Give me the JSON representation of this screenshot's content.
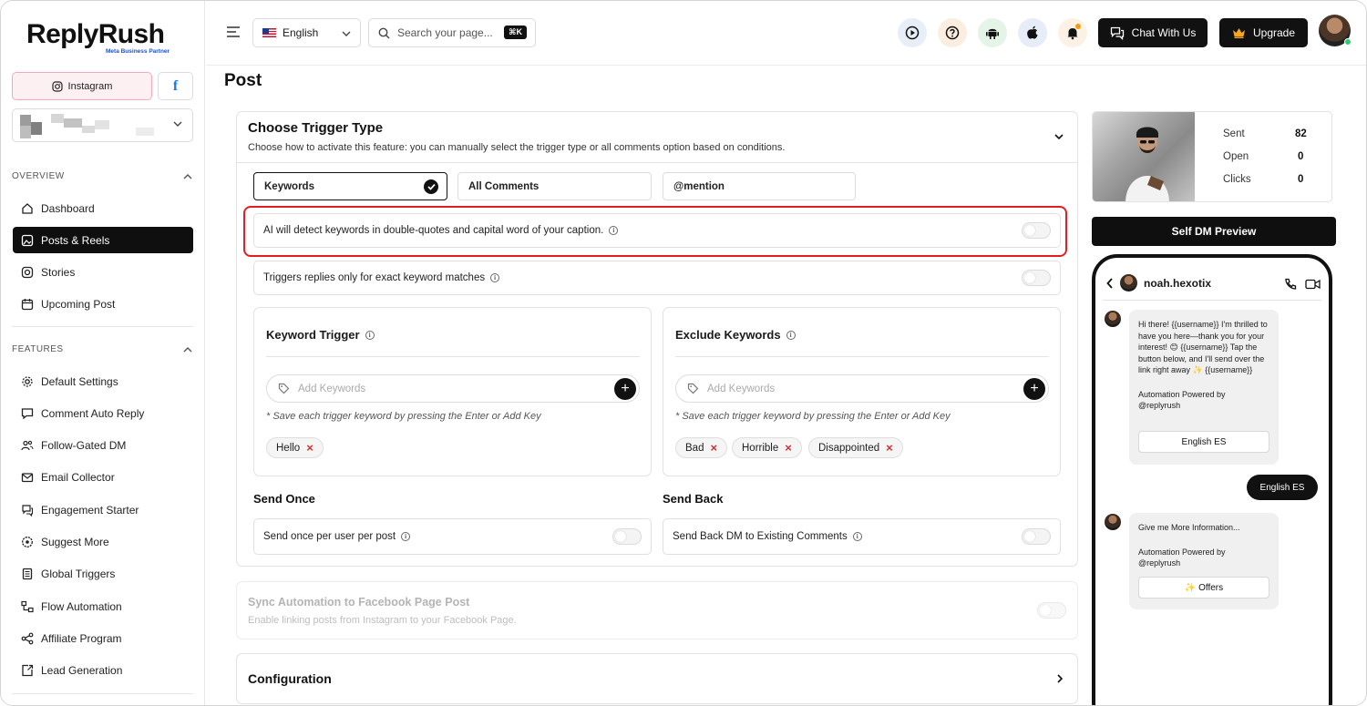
{
  "brand": {
    "name": "ReplyRush",
    "tagline": "Meta Business Partner"
  },
  "platform_tabs": {
    "instagram_label": "Instagram",
    "facebook_label": "f"
  },
  "sidebar": {
    "overview_label": "OVERVIEW",
    "features_label": "FEATURES",
    "overview_items": [
      {
        "label": "Dashboard",
        "icon": "home-icon",
        "active": false
      },
      {
        "label": "Posts & Reels",
        "icon": "image-icon",
        "active": true
      },
      {
        "label": "Stories",
        "icon": "instagram-icon",
        "active": false
      },
      {
        "label": "Upcoming Post",
        "icon": "calendar-icon",
        "active": false
      }
    ],
    "feature_items": [
      {
        "label": "Default Settings",
        "icon": "gear-icon"
      },
      {
        "label": "Comment Auto Reply",
        "icon": "comment-icon"
      },
      {
        "label": "Follow-Gated DM",
        "icon": "users-icon"
      },
      {
        "label": "Email Collector",
        "icon": "mail-icon"
      },
      {
        "label": "Engagement Starter",
        "icon": "chat-icon"
      },
      {
        "label": "Suggest More",
        "icon": "badge-icon"
      },
      {
        "label": "Global Triggers",
        "icon": "book-icon"
      },
      {
        "label": "Flow Automation",
        "icon": "flow-icon"
      },
      {
        "label": "Affiliate Program",
        "icon": "share-icon"
      },
      {
        "label": "Lead Generation",
        "icon": "lead-icon"
      }
    ]
  },
  "topbar": {
    "language": "English",
    "search_placeholder": "Search your page...",
    "search_shortcut": "⌘K",
    "chat_label": "Chat With Us",
    "upgrade_label": "Upgrade"
  },
  "page": {
    "title": "Post"
  },
  "trigger": {
    "title": "Choose Trigger Type",
    "subtitle": "Choose how to activate this feature: you can manually select the trigger type or all comments option based on conditions.",
    "types": [
      "Keywords",
      "All Comments",
      "@mention"
    ],
    "selected": "Keywords",
    "ai_detect_label": "AI will detect keywords in double-quotes and capital word of your caption.",
    "ai_detect_on": false,
    "exact_match_label": "Triggers replies only for exact keyword matches",
    "exact_match_on": false
  },
  "keyword_trigger": {
    "title": "Keyword Trigger",
    "placeholder": "Add Keywords",
    "hint": "* Save each trigger keyword by pressing the Enter or Add Key",
    "keywords": [
      "Hello"
    ]
  },
  "exclude_keywords": {
    "title": "Exclude Keywords",
    "placeholder": "Add Keywords",
    "hint": "* Save each trigger keyword by pressing the Enter or Add Key",
    "keywords": [
      "Bad",
      "Horrible",
      "Disappointed"
    ]
  },
  "send_once": {
    "title": "Send Once",
    "label": "Send once per user per post",
    "on": false
  },
  "send_back": {
    "title": "Send Back",
    "label": "Send Back DM to Existing Comments",
    "on": false
  },
  "sync": {
    "title": "Sync Automation to Facebook Page Post",
    "subtitle": "Enable linking posts from Instagram to your Facebook Page.",
    "on": false
  },
  "configuration": {
    "title": "Configuration"
  },
  "stats": {
    "sent_label": "Sent",
    "sent": "82",
    "open_label": "Open",
    "open": "0",
    "clicks_label": "Clicks",
    "clicks": "0"
  },
  "preview": {
    "button_label": "Self DM Preview",
    "username": "noah.hexotix",
    "message1": "Hi there! {{username}} I'm thrilled to have you here—thank you for your interest! 😊 {{username}} Tap the button below, and I'll send over the link right away ✨ {{username}}",
    "powered1": "Automation Powered by @replyrush",
    "button1": "English ES",
    "reply": "English ES",
    "message2": "Give me More Information...",
    "powered2": "Automation Powered by @replyrush",
    "button2": "✨ Offers"
  }
}
